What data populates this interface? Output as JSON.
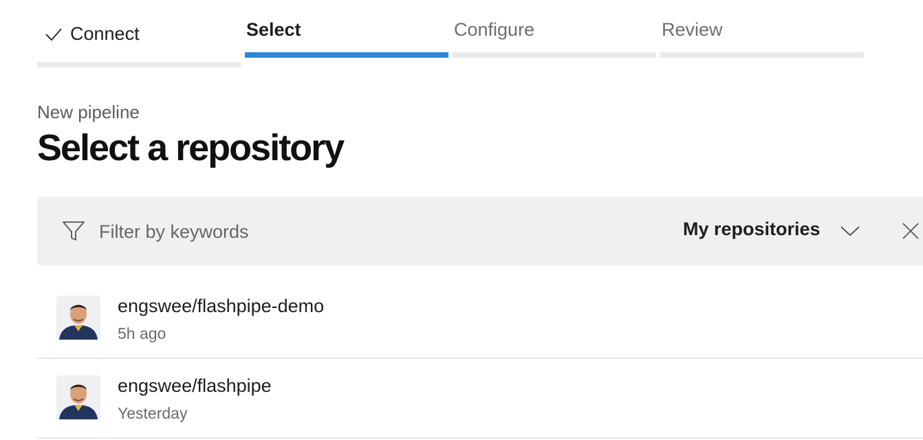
{
  "wizard": {
    "steps": [
      {
        "label": "Connect",
        "state": "completed"
      },
      {
        "label": "Select",
        "state": "active"
      },
      {
        "label": "Configure",
        "state": "pending"
      },
      {
        "label": "Review",
        "state": "pending"
      }
    ]
  },
  "header": {
    "subtitle": "New pipeline",
    "title": "Select a repository"
  },
  "filter": {
    "placeholder": "Filter by keywords",
    "value": "",
    "scope_selected": "My repositories"
  },
  "repositories": [
    {
      "name": "engswee/flashpipe-demo",
      "updated": "5h ago"
    },
    {
      "name": "engswee/flashpipe",
      "updated": "Yesterday"
    }
  ],
  "colors": {
    "accent": "#2f86d6",
    "inactive_bar": "#eaeaea",
    "filter_bg": "#f0f0f0"
  }
}
